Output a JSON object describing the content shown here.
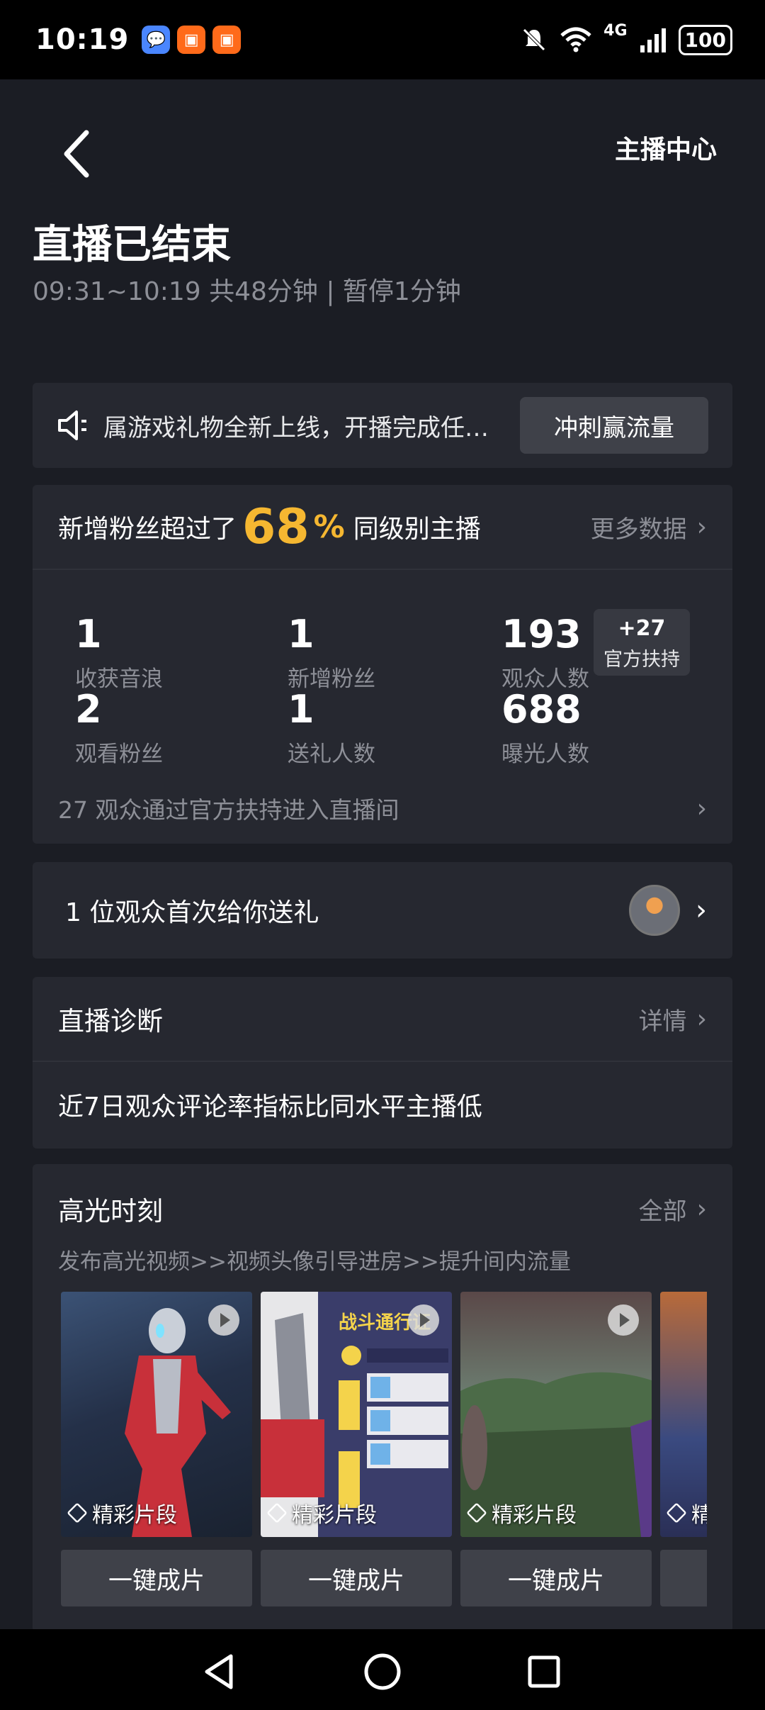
{
  "status_bar": {
    "time": "10:19",
    "network": "4G",
    "battery": "100"
  },
  "header": {
    "right_link": "主播中心"
  },
  "summary": {
    "title": "直播已结束",
    "subtitle": "09:31~10:19 共48分钟 | 暂停1分钟"
  },
  "notice": {
    "text": "属游戏礼物全新上线，开播完成任…",
    "button": "冲刺赢流量"
  },
  "stats": {
    "headline_prefix": "新增粉丝超过了",
    "headline_percent": "68",
    "headline_percent_sign": "%",
    "headline_suffix": "同级别主播",
    "more_label": "更多数据",
    "items": [
      {
        "value": "1",
        "label": "收获音浪"
      },
      {
        "value": "1",
        "label": "新增粉丝"
      },
      {
        "value": "193",
        "label": "观众人数"
      },
      {
        "value": "2",
        "label": "观看粉丝"
      },
      {
        "value": "1",
        "label": "送礼人数"
      },
      {
        "value": "688",
        "label": "曝光人数"
      }
    ],
    "boost_value": "+27",
    "boost_label": "官方扶持",
    "support_text": "27 观众通过官方扶持进入直播间"
  },
  "gift": {
    "text": "1 位观众首次给你送礼"
  },
  "diagnosis": {
    "title": "直播诊断",
    "detail_label": "详情",
    "message": "近7日观众评论率指标比同水平主播低"
  },
  "highlights": {
    "title": "高光时刻",
    "all_label": "全部",
    "subtitle": "发布高光视频>>视频头像引导进房>>提升间内流量",
    "clips": [
      {
        "label": "精彩片段",
        "button": "一键成片"
      },
      {
        "label": "精彩片段",
        "button": "一键成片"
      },
      {
        "label": "精彩片段",
        "button": "一键成片"
      },
      {
        "label": "精",
        "button": ""
      }
    ]
  },
  "colors": {
    "background": "#1b1d24",
    "card": "#262830",
    "accent": "#f5b731",
    "muted": "#8d8f97"
  }
}
